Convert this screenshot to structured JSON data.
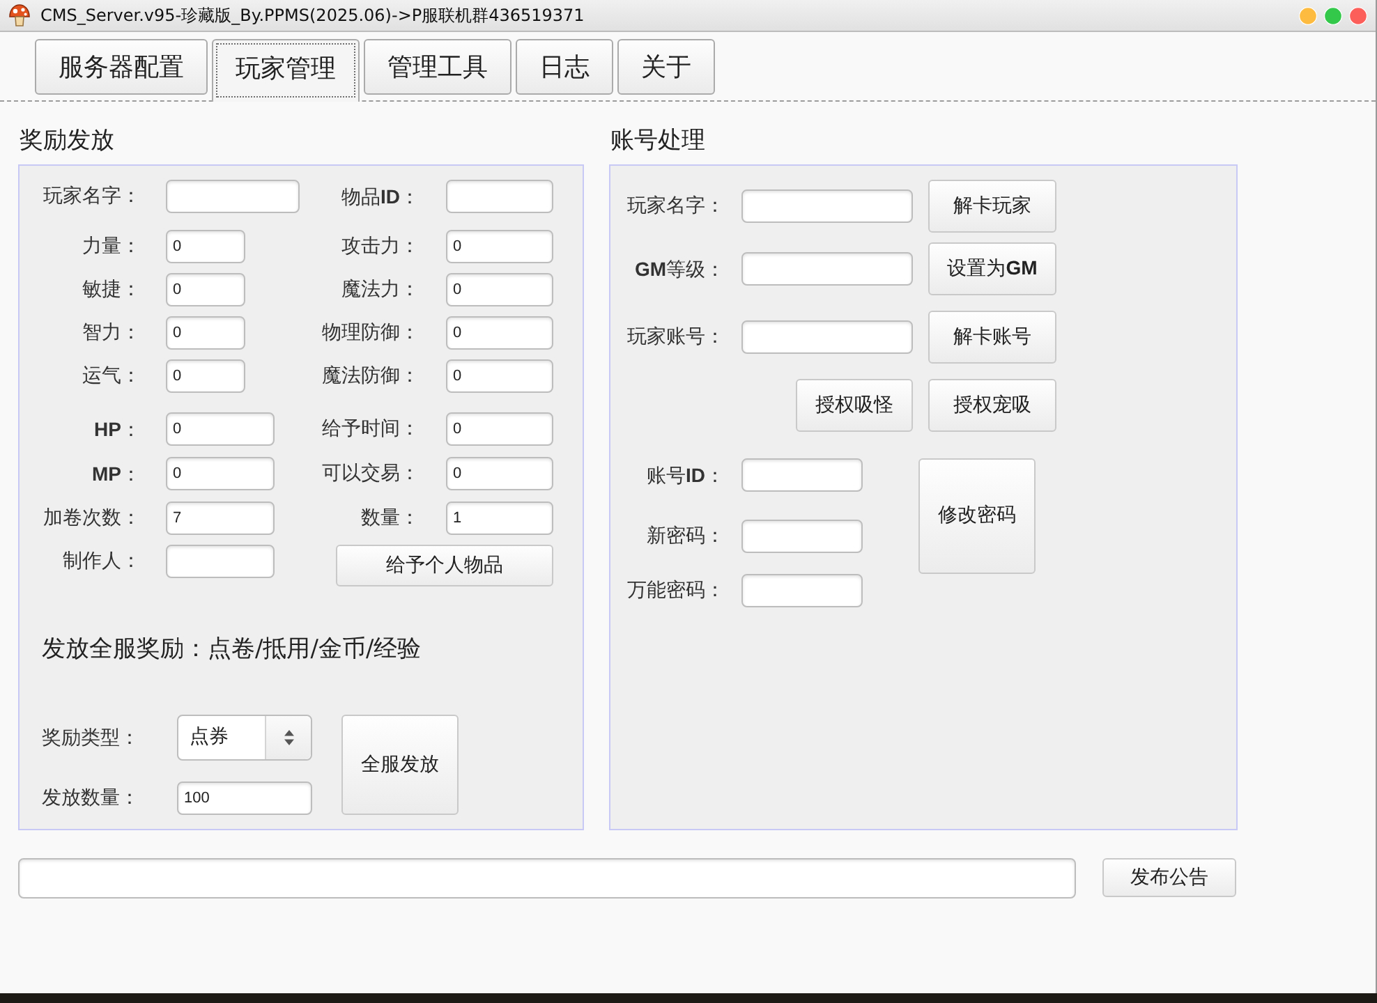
{
  "window": {
    "title": "CMS_Server.v95-珍藏版_By.PPMS(2025.06)->P服联机群436519371"
  },
  "tabs": [
    {
      "label": "服务器配置",
      "selected": false
    },
    {
      "label": "玩家管理",
      "selected": true
    },
    {
      "label": "管理工具",
      "selected": false
    },
    {
      "label": "日志",
      "selected": false
    },
    {
      "label": "关于",
      "selected": false
    }
  ],
  "reward": {
    "title": "奖励发放",
    "groups": [
      [
        [
          {
            "kind": "input",
            "label": "玩家名字："
          },
          {
            "kind": "input",
            "label": "物品**ID**："
          }
        ]
      ],
      [
        [
          {
            "kind": "input",
            "label": "力量：",
            "value": "0"
          },
          {
            "kind": "input",
            "label": "攻击力：",
            "value": "0"
          }
        ],
        [
          {
            "kind": "input",
            "label": "敏捷：",
            "value": "0"
          },
          {
            "kind": "input",
            "label": "魔法力：",
            "value": "0"
          }
        ],
        [
          {
            "kind": "input",
            "label": "智力：",
            "value": "0"
          },
          {
            "kind": "input",
            "label": "物理防御：",
            "value": "0"
          }
        ],
        [
          {
            "kind": "input",
            "label": "运气：",
            "value": "0"
          },
          {
            "kind": "input",
            "label": "魔法防御：",
            "value": "0"
          }
        ]
      ],
      [
        [
          {
            "kind": "input",
            "label": "**HP**：",
            "value": "0"
          },
          {
            "kind": "input",
            "label": "给予时间：",
            "value": "0"
          }
        ],
        [
          {
            "kind": "input",
            "label": "**MP**：",
            "value": "0"
          },
          {
            "kind": "input",
            "label": "可以交易：",
            "value": "0"
          }
        ],
        [
          {
            "kind": "input",
            "label": "加卷次数：",
            "value": "7"
          },
          {
            "kind": "input",
            "label": "数量：",
            "value": "1"
          }
        ],
        [
          {
            "kind": "input",
            "label": "制作人："
          },
          {
            "kind": "button",
            "label": "给予个人物品"
          }
        ]
      ]
    ]
  },
  "global_reward": {
    "title": "发放全服奖励：点卷/抵用/金币/经验",
    "type_field": {
      "label": "奖励类型：",
      "value": "点券"
    },
    "amount_field": {
      "label": "发放数量：",
      "value": "100"
    },
    "button": "全服发放"
  },
  "account": {
    "title": "账号处理",
    "rows": [
      {
        "label": "玩家名字：",
        "button": "解卡玩家"
      },
      {
        "label": "**GM**等级：",
        "button": "设置为**GM**"
      },
      {
        "label": "玩家账号：",
        "button": "解卡账号"
      }
    ],
    "grant_buttons": [
      "授权吸怪",
      "授权宠吸"
    ],
    "password_fields": [
      {
        "label": "账号**ID**："
      },
      {
        "label": "新密码："
      },
      {
        "label": "万能密码："
      }
    ],
    "password_button": "修改密码"
  },
  "announcement": {
    "button": "发布公告"
  }
}
